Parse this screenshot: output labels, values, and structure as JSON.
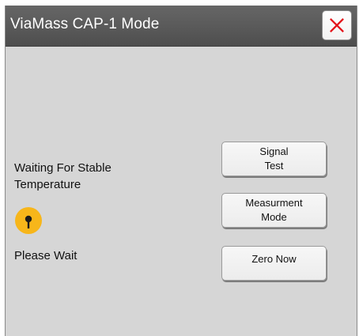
{
  "window": {
    "title": "ViaMass CAP-1 Mode"
  },
  "status": {
    "line1": "Waiting For Stable",
    "line2": "Temperature",
    "wait_text": "Please Wait",
    "indicator_icon": "status-indicator-icon",
    "indicator_color": "#f7b61a"
  },
  "buttons": {
    "signal_test": {
      "line1": "Signal",
      "line2": "Test"
    },
    "measurement_mode": {
      "line1": "Measurment",
      "line2": "Mode"
    },
    "zero_now": {
      "line1": "Zero Now"
    }
  },
  "icons": {
    "close": "close-icon"
  },
  "colors": {
    "title_bar": "#585858",
    "window_bg": "#d6d6d6",
    "close_x": "#e4141b"
  }
}
